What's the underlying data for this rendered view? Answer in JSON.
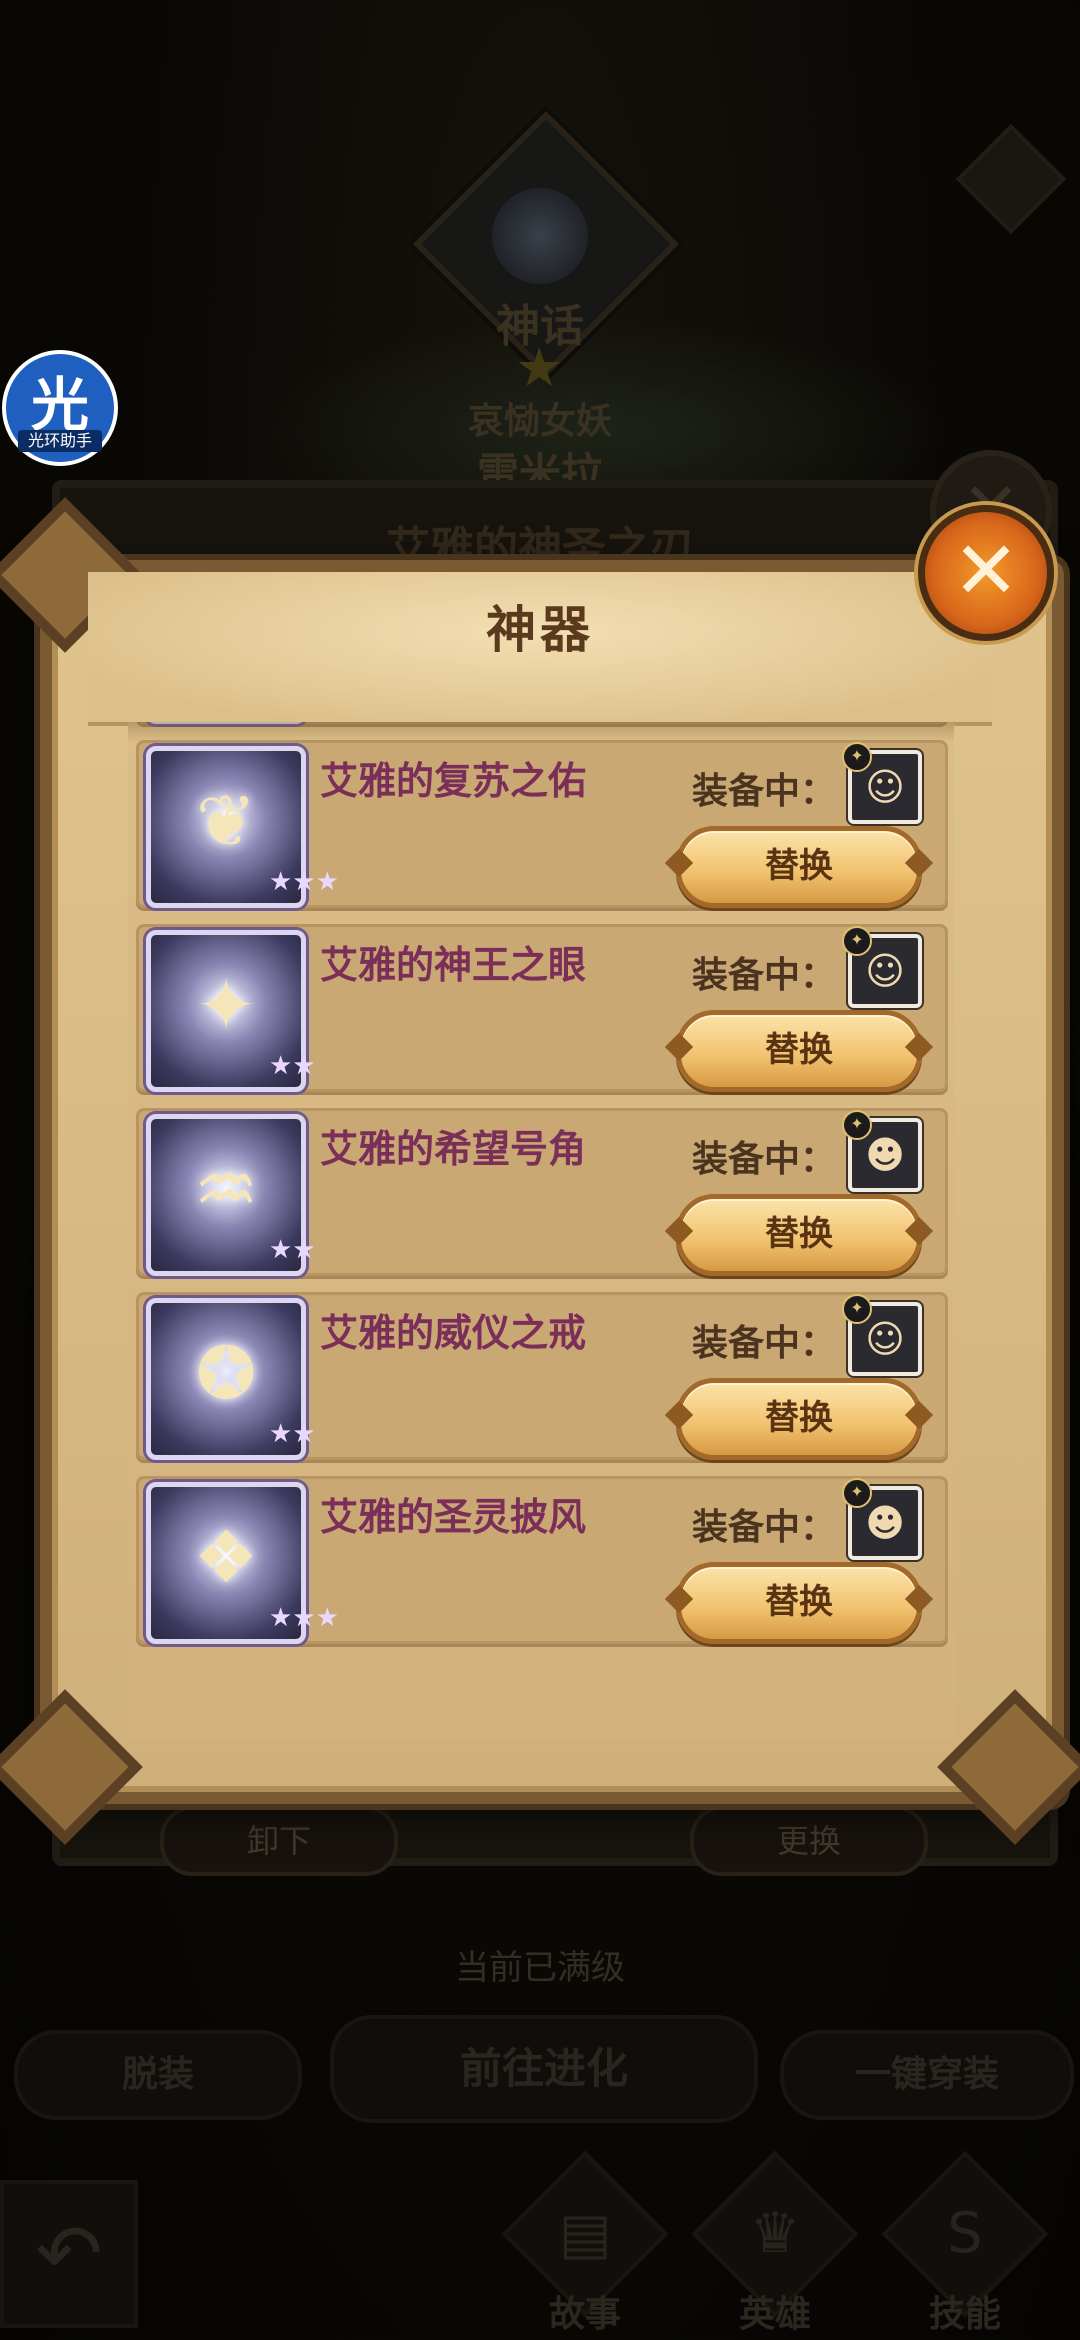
{
  "background": {
    "rank_label": "神话",
    "hero_title": "哀恸女妖",
    "hero_name": "雷米拉",
    "panel_title": "艾雅的神圣之刃",
    "unequip_label": "卸下",
    "change_label": "更换",
    "max_level_text": "当前已满级",
    "strip_label": "脱装",
    "evolve_label": "前往进化",
    "one_click_equip_label": "一键穿装",
    "nav": [
      {
        "label": "故事",
        "icon": "book-icon"
      },
      {
        "label": "英雄",
        "icon": "hero-helmet-icon"
      },
      {
        "label": "技能",
        "icon": "skill-s-icon"
      }
    ]
  },
  "assistant": {
    "glyph": "光",
    "label": "光环助手",
    "color": "#1f5fbf"
  },
  "modal": {
    "title": "神器",
    "equipped_label": "装备中：",
    "replace_label": "替换",
    "items": [
      {
        "name": "",
        "stars": "★★",
        "glyph": "✵",
        "portrait": "☺",
        "show_equip": false
      },
      {
        "name": "艾雅的复苏之佑",
        "stars": "★★★",
        "glyph": "❦",
        "portrait": "☺"
      },
      {
        "name": "艾雅的神王之眼",
        "stars": "★★",
        "glyph": "✦",
        "portrait": "☺"
      },
      {
        "name": "艾雅的希望号角",
        "stars": "★★",
        "glyph": "♒",
        "portrait": "☻"
      },
      {
        "name": "艾雅的威仪之戒",
        "stars": "★★",
        "glyph": "✪",
        "portrait": "☺"
      },
      {
        "name": "艾雅的圣灵披风",
        "stars": "★★★",
        "glyph": "❖",
        "portrait": "☻"
      }
    ]
  },
  "colors": {
    "accent": "#d8661a",
    "item_name": "#7a2e58",
    "button": "#f2c472"
  }
}
